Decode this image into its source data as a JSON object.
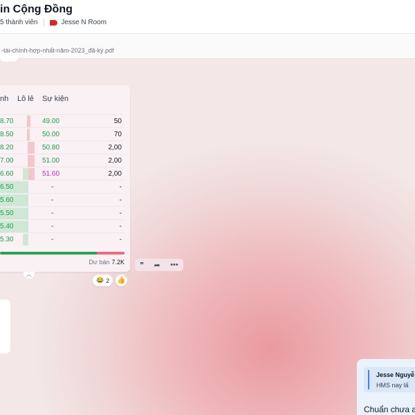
{
  "header": {
    "title": "in Cộng Đồng",
    "members": "5 thành viên",
    "tag_label": "Jesse N Room"
  },
  "file": {
    "name": "-tài-chính-hợp-nhất-năm-2023_đã-ký.pdf"
  },
  "order_book": {
    "columns": [
      "nh",
      "Lô lẻ",
      "Sự kiện"
    ],
    "rows": [
      {
        "price": "8.70",
        "event": "49.00",
        "event_color": "green",
        "volume": "50"
      },
      {
        "price": "8.50",
        "event": "50.00",
        "event_color": "green",
        "volume": "70"
      },
      {
        "price": "8.20",
        "event": "50.80",
        "event_color": "green",
        "volume": "2,00"
      },
      {
        "price": "7.00",
        "event": "51.00",
        "event_color": "green",
        "volume": "2,00"
      },
      {
        "price": "6.60",
        "event": "51.60",
        "event_color": "magenta",
        "volume": "2,00"
      },
      {
        "price": "6.50",
        "event": "-",
        "event_color": "dash",
        "volume": "-"
      },
      {
        "price": "5.60",
        "event": "-",
        "event_color": "dash",
        "volume": "-"
      },
      {
        "price": "5.50",
        "event": "-",
        "event_color": "dash",
        "volume": "-"
      },
      {
        "price": "5.40",
        "event": "-",
        "event_color": "dash",
        "volume": "-"
      },
      {
        "price": "5.30",
        "event": "-",
        "event_color": "dash",
        "volume": "-"
      }
    ],
    "sell_ratio": 0.22,
    "balance_label": "Dư bán",
    "balance_value": "7.2K"
  },
  "reactions": {
    "count": "2",
    "emoji": "😂"
  },
  "actions": {
    "quote_icon": "quote-icon",
    "share_icon": "share-icon",
    "more_icon": "more-icon"
  },
  "message": {
    "quote_author": "Jesse Nguyễ",
    "quote_text": "HMS nay lấ",
    "text": "Chuẩn chưa an"
  },
  "colors": {
    "buy": "#16a34a",
    "sell": "#f06a7a",
    "accent": "#3b82f6",
    "tag": "#dc2626"
  }
}
